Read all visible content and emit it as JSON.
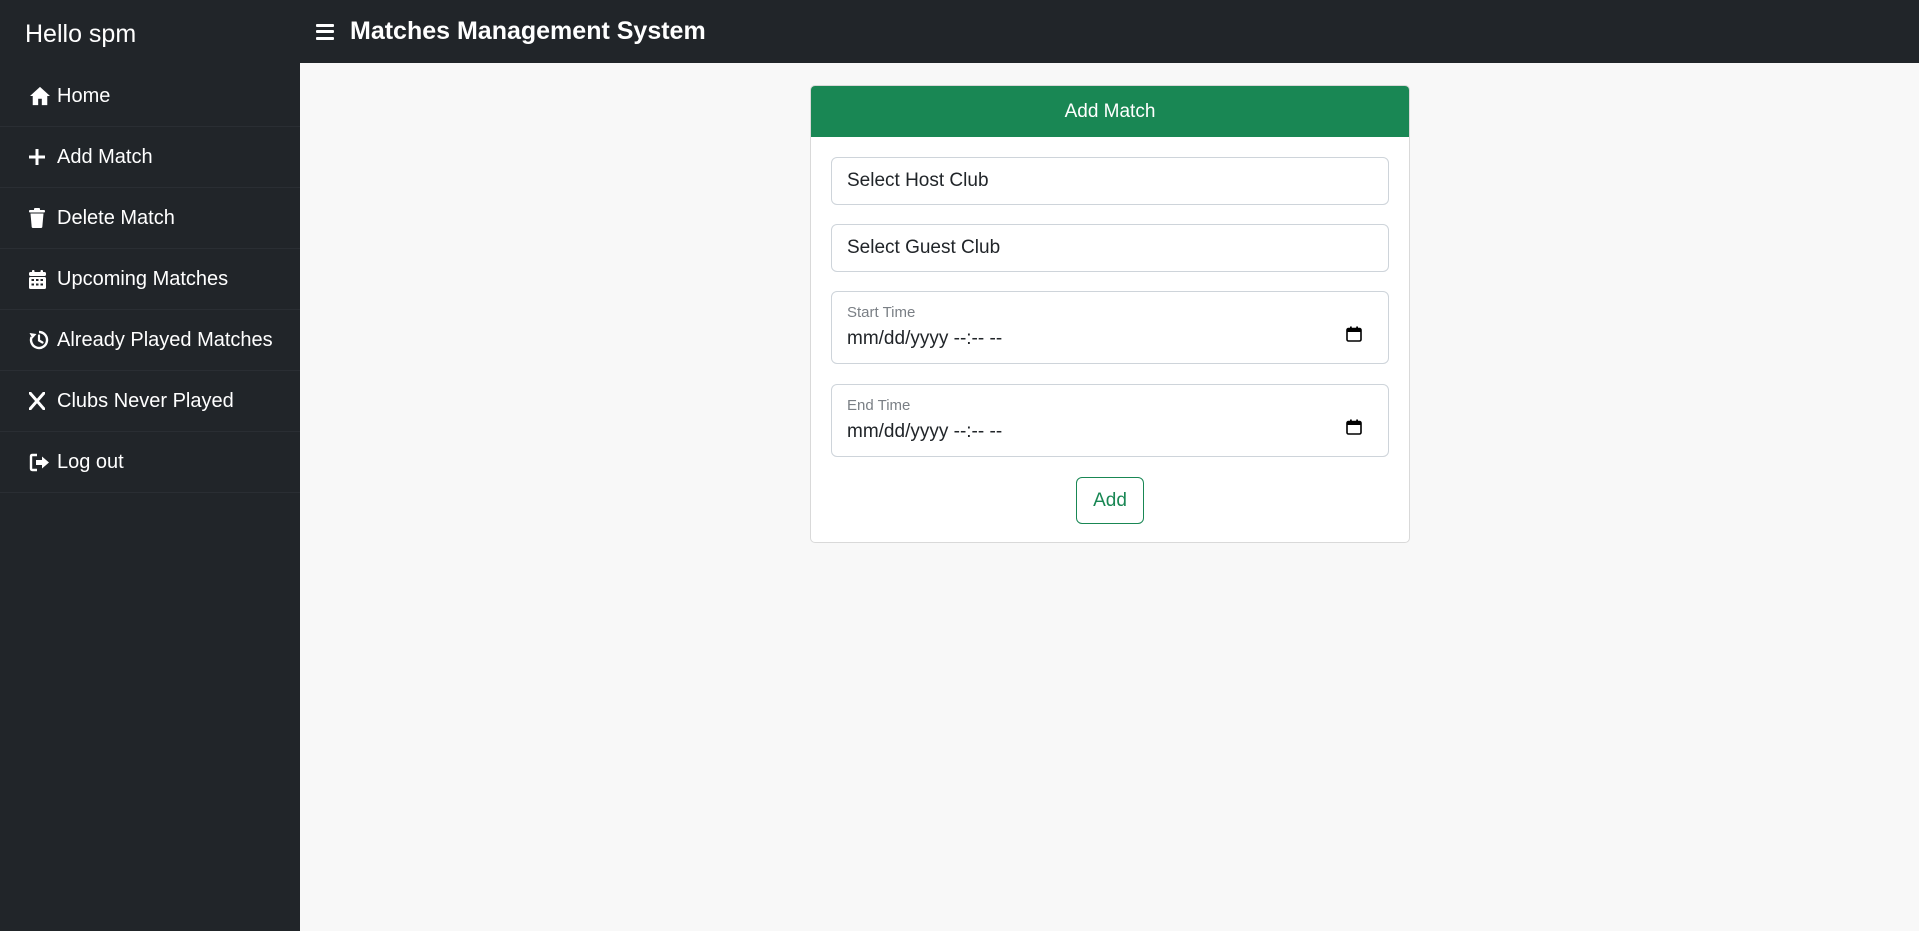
{
  "sidebar": {
    "greeting": "Hello spm",
    "items": [
      {
        "label": "Home",
        "icon": "home-icon"
      },
      {
        "label": "Add Match",
        "icon": "plus-icon"
      },
      {
        "label": "Delete Match",
        "icon": "trash-icon"
      },
      {
        "label": "Upcoming Matches",
        "icon": "calendar-icon"
      },
      {
        "label": "Already Played Matches",
        "icon": "history-icon"
      },
      {
        "label": "Clubs Never Played",
        "icon": "x-icon"
      },
      {
        "label": "Log out",
        "icon": "logout-icon"
      }
    ]
  },
  "header": {
    "title": "Matches Management System",
    "menu_icon": "hamburger-menu-icon"
  },
  "form": {
    "title": "Add Match",
    "host_club_placeholder": "Select Host Club",
    "guest_club_placeholder": "Select Guest Club",
    "start_time_label": "Start Time",
    "start_time_value": "mm/dd/yyyy --:-- --",
    "end_time_label": "End Time",
    "end_time_value": "mm/dd/yyyy --:-- --",
    "submit_label": "Add"
  },
  "colors": {
    "sidebar_bg": "#212529",
    "accent": "#198754",
    "page_bg": "#f8f8f8"
  }
}
